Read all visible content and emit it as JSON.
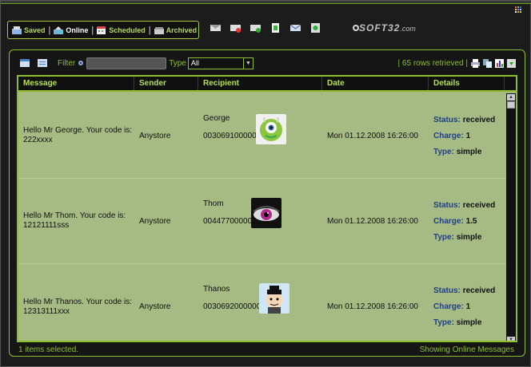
{
  "tabs": [
    {
      "label": "Saved",
      "icon": "saved-icon",
      "active": false
    },
    {
      "label": "Online",
      "icon": "online-icon",
      "active": true
    },
    {
      "label": "Scheduled",
      "icon": "scheduled-icon",
      "active": false
    },
    {
      "label": "Archived",
      "icon": "archived-icon",
      "active": false
    }
  ],
  "toolbar": {
    "icons": [
      "compose-icon",
      "delete-icon",
      "forward-icon",
      "export-icon",
      "mail-icon",
      "refresh-icon"
    ],
    "watermark": "SOFT32",
    "watermark_suffix": ".com"
  },
  "filter": {
    "label": "Filter",
    "value": "",
    "type_label": "Type",
    "type_value": "All"
  },
  "summary": {
    "rows_retrieved": "| 65 rows retrieved |"
  },
  "columns": {
    "message": "Message",
    "sender": "Sender",
    "recipient": "Recipient",
    "date": "Date",
    "details": "Details"
  },
  "rows": [
    {
      "message": "Hello Mr George. Your code is: 222xxxx",
      "sender": "Anystore",
      "recipient_name": "George",
      "recipient_number": "003069100000",
      "avatar": "monster-avatar",
      "date": "Mon 01.12.2008 16:26:00",
      "status_label": "Status:",
      "status": "received",
      "charge_label": "Charge:",
      "charge": "1",
      "type_label": "Type:",
      "type": "simple"
    },
    {
      "message": "Hello Mr Thom. Your code is: 12121111sss",
      "sender": "Anystore",
      "recipient_name": "Thom",
      "recipient_number": "00447700000",
      "avatar": "eye-avatar",
      "date": "Mon 01.12.2008 16:26:00",
      "status_label": "Status:",
      "status": "received",
      "charge_label": "Charge:",
      "charge": "1.5",
      "type_label": "Type:",
      "type": "simple"
    },
    {
      "message": "Hello Mr Thanos. Your code is: 12313111xxx",
      "sender": "Anystore",
      "recipient_name": "Thanos",
      "recipient_number": "0030692000000",
      "avatar": "cartoon-avatar",
      "date": "Mon 01.12.2008 16:26:00",
      "status_label": "Status:",
      "status": "received",
      "charge_label": "Charge:",
      "charge": "1",
      "type_label": "Type:",
      "type": "simple"
    }
  ],
  "footer": {
    "selected": "1  items selected.",
    "showing": "Showing Online Messages"
  },
  "colors": {
    "accent": "#8ebd2e",
    "grid_bg": "#a6ba84",
    "detail_key": "#1f3f8a"
  }
}
